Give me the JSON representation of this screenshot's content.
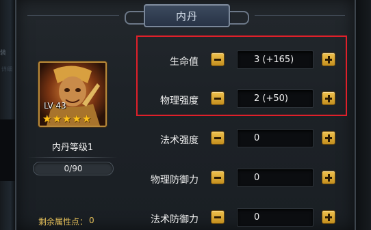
{
  "window": {
    "title": "内丹"
  },
  "background": {
    "ghost_text_1": "装",
    "ghost_text_2": "详细"
  },
  "hero": {
    "level": "LV 43",
    "stars": 5,
    "dan_level": "内丹等级1",
    "exp": "0/90",
    "exp_progress": 0,
    "remaining_label": "剩余属性点：",
    "remaining_value": "0"
  },
  "stats": [
    {
      "label": "生命值",
      "value": "3 (+165)"
    },
    {
      "label": "物理强度",
      "value": "2 (+50)"
    },
    {
      "label": "法术强度",
      "value": "0"
    },
    {
      "label": "物理防御力",
      "value": "0"
    },
    {
      "label": "法术防御力",
      "value": "0"
    }
  ],
  "colors": {
    "button": "#e0a83a",
    "highlight": "#e0202a",
    "star": "#ffc21a",
    "remaining_text": "#e8c25a"
  }
}
